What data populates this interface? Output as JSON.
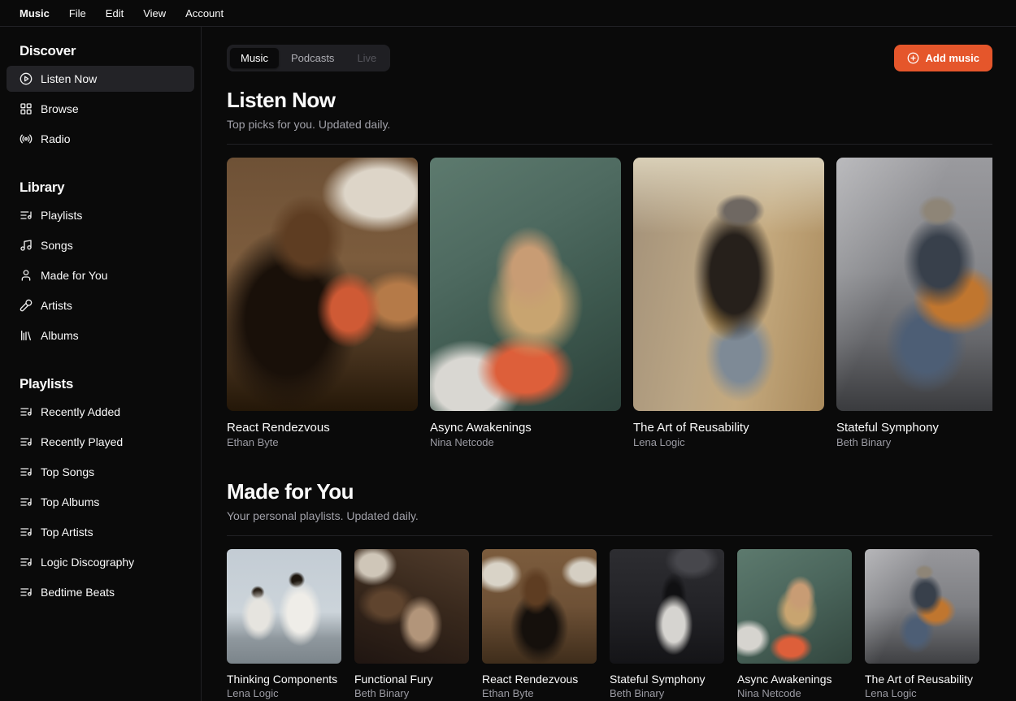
{
  "menubar": {
    "items": [
      {
        "label": "Music",
        "bold": true
      },
      {
        "label": "File"
      },
      {
        "label": "Edit"
      },
      {
        "label": "View"
      },
      {
        "label": "Account"
      }
    ]
  },
  "sidebar": {
    "sections": [
      {
        "title": "Discover",
        "items": [
          {
            "label": "Listen Now",
            "icon": "play-circle",
            "active": true
          },
          {
            "label": "Browse",
            "icon": "layout-grid"
          },
          {
            "label": "Radio",
            "icon": "radio"
          }
        ]
      },
      {
        "title": "Library",
        "items": [
          {
            "label": "Playlists",
            "icon": "list-music"
          },
          {
            "label": "Songs",
            "icon": "music"
          },
          {
            "label": "Made for You",
            "icon": "user"
          },
          {
            "label": "Artists",
            "icon": "mic"
          },
          {
            "label": "Albums",
            "icon": "library"
          }
        ]
      },
      {
        "title": "Playlists",
        "items": [
          {
            "label": "Recently Added",
            "icon": "list-music"
          },
          {
            "label": "Recently Played",
            "icon": "list-music"
          },
          {
            "label": "Top Songs",
            "icon": "list-music"
          },
          {
            "label": "Top Albums",
            "icon": "list-music"
          },
          {
            "label": "Top Artists",
            "icon": "list-music"
          },
          {
            "label": "Logic Discography",
            "icon": "list-music"
          },
          {
            "label": "Bedtime Beats",
            "icon": "list-music"
          }
        ]
      }
    ]
  },
  "tabs": {
    "items": [
      {
        "label": "Music",
        "active": true
      },
      {
        "label": "Podcasts"
      },
      {
        "label": "Live",
        "disabled": true
      }
    ]
  },
  "add_music": {
    "label": "Add music",
    "icon": "plus-circle",
    "color": "#e5562b"
  },
  "sections": {
    "listen_now": {
      "title": "Listen Now",
      "subtitle": "Top picks for you. Updated daily.",
      "albums": [
        {
          "title": "React Rendezvous",
          "artist": "Ethan Byte",
          "art_desc": "woman with headphones writing at a wooden bookshelf",
          "art": "radial-gradient(95px 65px at 80% 14%, #ddd5c8 0%, #ddd5c8 45%, rgba(221,213,200,0) 75%), radial-gradient(55px 65px at 64% 60%, #cf5a35 0%, #cf5a35 40%, rgba(207,90,53,0) 72%), radial-gradient(70px 55px at 90% 57%, #b57a48 0%, #b57a48 40%, rgba(181,122,72,0) 70%), radial-gradient(65px 75px at 42% 32%, #5e3d22 0%, #5e3d22 40%, rgba(94,61,34,0) 72%), radial-gradient(115px 150px at 32% 64%, #191009 0%, #191009 45%, rgba(25,16,9,0) 75%), linear-gradient(180deg, #6e5136 0%, #7c5c3d 40%, #4a3520 75%, #241708 100%)"
        },
        {
          "title": "Async Awakenings",
          "artist": "Nina Netcode",
          "art_desc": "blonde woman in orange top against green glass",
          "art": "radial-gradient(60px 75px at 52% 44%, #c89c74 0%, #c89c74 35%, rgba(200,156,116,0) 70%), radial-gradient(85px 95px at 55% 58%, #c8a470 0%, #c8a470 35%, rgba(200,164,112,0) 70%), radial-gradient(80px 60px at 50% 84%, #dd5f3a 0%, #dd5f3a 45%, rgba(221,95,58,0) 75%), radial-gradient(90px 75px at 20% 90%, #d9d7d2 0%, #d9d7d2 45%, rgba(217,215,210,0) 75%), linear-gradient(150deg, #5d7a6e 0%, #4e6a60 35%, #3d584e 65%, #2c413a 100%)"
        },
        {
          "title": "The Art of Reusability",
          "artist": "Lena Logic",
          "art_desc": "man in hat playing saxophone on a warm street",
          "art": "radial-gradient(38px 26px at 56% 21%, #6f6862 0%, #6f6862 50%, rgba(111,104,98,0) 80%), radial-gradient(70px 115px at 53% 46%, #26201b 0%, #26201b 42%, rgba(38,32,27,0) 72%), radial-gradient(42px 85px at 47% 55%, #c49a52 0%, #c49a52 32%, rgba(196,154,82,0) 66%), radial-gradient(60px 80px at 56% 78%, #7e8a96 0%, #7e8a96 40%, rgba(126,138,150,0) 72%), linear-gradient(180deg, #d9cfb7 0%, rgba(217,207,183,0) 30%), linear-gradient(100deg, #a39179 0%, #baa584 40%, #c4a97e 62%, #a98a5c 100%)"
        },
        {
          "title": "Stateful Symphony",
          "artist": "Beth Binary",
          "art_desc": "busker in beanie playing acoustic guitar by stone wall",
          "art": "radial-gradient(30px 24px at 53% 21%, #8e8577 0%, #8e8577 50%, rgba(142,133,119,0) 80%), radial-gradient(62px 78px at 54% 41%, #38404b 0%, #38404b 40%, rgba(56,64,75,0) 72%), radial-gradient(72px 58px at 63% 56%, #c0762f 0%, #c0762f 45%, rgba(192,118,47,0) 75%), radial-gradient(70px 82px at 47% 74%, #4d5e75 0%, #4d5e75 40%, rgba(77,94,117,0) 72%), linear-gradient(115deg, rgba(255,255,255,0.32) 0%, rgba(255,255,255,0) 38%), linear-gradient(180deg, #9a9a9e 0%, #85868a 45%, #66676b 72%, #3a3b3e 100%)"
        }
      ]
    },
    "made_for_you": {
      "title": "Made for You",
      "subtitle": "Your personal playlists. Updated daily.",
      "albums": [
        {
          "title": "Thinking Components",
          "artist": "Lena Logic",
          "art_desc": "two people in white crouching under bright sky",
          "art": "radial-gradient(34px 52px at 64% 56%, #efede8 0%, #efede8 45%, rgba(239,237,232,0) 78%), radial-gradient(28px 40px at 28% 58%, #e6e4df 0%, #e6e4df 45%, rgba(230,228,223,0) 78%), radial-gradient(12px 12px at 61% 27%, #1d160e 0%, #1d160e 50%, rgba(29,22,14,0) 85%), radial-gradient(10px 10px at 27% 38%, #2a2118 0%, #2a2118 50%, rgba(42,33,24,0) 85%), linear-gradient(180deg, #c3ccd4 0%, #ccd4da 55%, #8f989e 78%, #7b848a 100%)"
        },
        {
          "title": "Functional Fury",
          "artist": "Beth Binary",
          "art_desc": "person playing piano in a dark record room",
          "art": "radial-gradient(40px 34px at 16% 14%, #cfc6b8 0%, #cfc6b8 40%, rgba(207,198,184,0) 75%), radial-gradient(36px 48px at 58% 66%, #b2957a 0%, #b2957a 40%, rgba(178,149,122,0) 74%), radial-gradient(48px 36px at 28% 48%, #5f442e 0%, #5f442e 40%, rgba(95,68,46,0) 74%), linear-gradient(200deg, #503c2c 0%, #38281c 45%, #1f1511 100%)"
        },
        {
          "title": "React Rendezvous",
          "artist": "Ethan Byte",
          "art_desc": "woman with headphones at bookshelf",
          "art": "radial-gradient(38px 30px at 14% 22%, #d9d3c7 0%, #d9d3c7 45%, rgba(217,211,199,0) 78%), radial-gradient(34px 26px at 88% 20%, #d5cfc3 0%, #d5cfc3 45%, rgba(213,207,195,0) 78%), radial-gradient(28px 40px at 47% 36%, #5e3d22 0%, #5e3d22 42%, rgba(94,61,34,0) 75%), radial-gradient(46px 58px at 50% 68%, #15100c 0%, #15100c 45%, rgba(21,16,12,0) 78%), linear-gradient(180deg, #7c5c3d 0%, #6e5136 50%, #3f2d1b 100%)"
        },
        {
          "title": "Stateful Symphony",
          "artist": "Beth Binary",
          "art_desc": "black and white, woman in knit dress seen from behind",
          "art": "radial-gradient(30px 48px at 56% 66%, #d6d4d0 0%, #d6d4d0 45%, rgba(214,212,208,0) 78%), radial-gradient(20px 38px at 56% 42%, #101012 0%, #101012 45%, rgba(16,16,18,0) 80%), radial-gradient(42px 30px at 72% 10%, #47474c 0%, #47474c 45%, rgba(71,71,76,0) 80%), linear-gradient(180deg, #2d2d31 0%, #232327 50%, #141417 100%)"
        },
        {
          "title": "Async Awakenings",
          "artist": "Nina Netcode",
          "art_desc": "blonde woman in orange top against green glass",
          "art": "radial-gradient(26px 32px at 55% 40%, #c89c74 0%, #c89c74 40%, rgba(200,156,116,0) 74%), radial-gradient(36px 42px at 52% 54%, #c8a470 0%, #c8a470 38%, rgba(200,164,112,0) 72%), radial-gradient(34px 24px at 47% 86%, #dd5f3a 0%, #dd5f3a 45%, rgba(221,95,58,0) 78%), radial-gradient(34px 30px at 10% 78%, #d6d4cf 0%, #d6d4cf 45%, rgba(214,212,207,0) 78%), linear-gradient(150deg, #5d7a6e 0%, #4b665c 45%, #32463e 100%)"
        },
        {
          "title": "The Art of Reusability",
          "artist": "Lena Logic",
          "art_desc": "busker in beanie playing acoustic guitar by stone wall",
          "art": "radial-gradient(14px 11px at 52% 20%, #8e8577 0%, #8e8577 50%, rgba(142,133,119,0) 85%), radial-gradient(28px 34px at 53% 40%, #38404b 0%, #38404b 42%, rgba(56,64,75,0) 75%), radial-gradient(32px 26px at 62% 54%, #c0762f 0%, #c0762f 45%, rgba(192,118,47,0) 78%), radial-gradient(30px 36px at 45% 72%, #4d5e75 0%, #4d5e75 40%, rgba(77,94,117,0) 74%), linear-gradient(115deg, rgba(255,255,255,0.3) 0%, rgba(255,255,255,0) 40%), linear-gradient(180deg, #97979b 0%, #7e7f83 50%, #3f4043 100%)"
        }
      ]
    }
  },
  "colors": {
    "background": "#0a0a0a",
    "border": "#212125",
    "accent": "#e5562b",
    "muted_text": "#9b9ba3"
  }
}
